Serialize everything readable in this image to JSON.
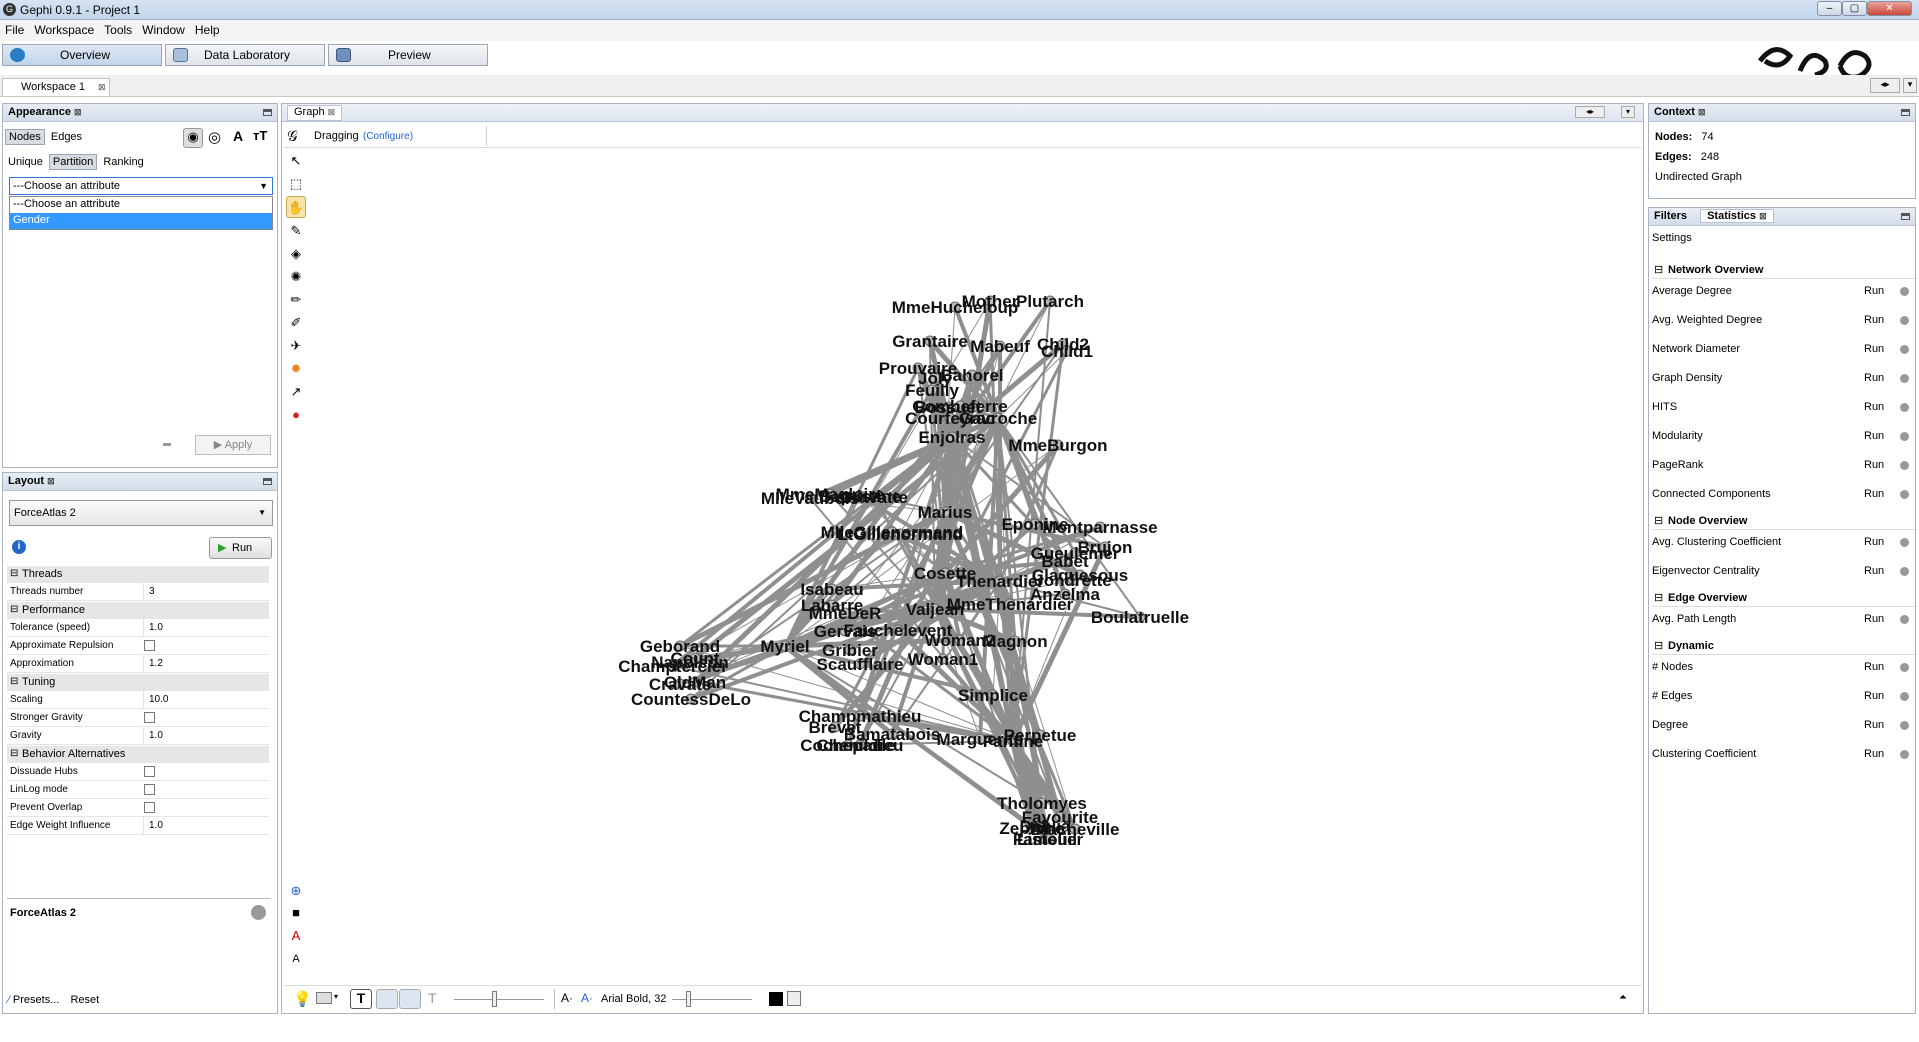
{
  "window": {
    "title": "Gephi 0.9.1 - Project 1"
  },
  "menu": [
    "File",
    "Workspace",
    "Tools",
    "Window",
    "Help"
  ],
  "modes": [
    "Overview",
    "Data Laboratory",
    "Preview"
  ],
  "workspace_tab": "Workspace 1",
  "appearance": {
    "title": "Appearance",
    "tabs": [
      "Nodes",
      "Edges"
    ],
    "modes": [
      "Unique",
      "Partition",
      "Ranking"
    ],
    "dropdown_value": "---Choose an attribute",
    "options": [
      "---Choose an attribute",
      "Gender"
    ],
    "apply": "Apply"
  },
  "layout": {
    "title": "Layout",
    "algorithm": "ForceAtlas 2",
    "run": "Run",
    "sections": {
      "threads": "Threads",
      "performance": "Performance",
      "tuning": "Tuning",
      "behavior": "Behavior Alternatives"
    },
    "props": [
      {
        "label": "Threads number",
        "value": "3"
      },
      {
        "label": "Tolerance (speed)",
        "value": "1.0"
      },
      {
        "label": "Approximate Repulsion",
        "value": ""
      },
      {
        "label": "Approximation",
        "value": "1.2"
      },
      {
        "label": "Scaling",
        "value": "10.0"
      },
      {
        "label": "Stronger Gravity",
        "value": ""
      },
      {
        "label": "Gravity",
        "value": "1.0"
      },
      {
        "label": "Dissuade Hubs",
        "value": ""
      },
      {
        "label": "LinLog mode",
        "value": ""
      },
      {
        "label": "Prevent Overlap",
        "value": ""
      },
      {
        "label": "Edge Weight Influence",
        "value": "1.0"
      }
    ],
    "desc_title": "ForceAtlas 2",
    "presets": "Presets...",
    "reset": "Reset"
  },
  "graph": {
    "tab": "Graph",
    "tool": "Dragging",
    "configure": "(Configure)",
    "font": "Arial Bold, 32",
    "labels": [
      [
        "MmeHucheloup",
        955,
        313
      ],
      [
        "Mother",
        990,
        307
      ],
      [
        "Plutarch",
        1050,
        307
      ],
      [
        "Grantaire",
        930,
        347
      ],
      [
        "Mabeuf",
        1000,
        352
      ],
      [
        "Child2",
        1063,
        350
      ],
      [
        "Child1",
        1067,
        357
      ],
      [
        "Prouvaire",
        918,
        374
      ],
      [
        "Joly",
        935,
        384
      ],
      [
        "Bahorel",
        972,
        381
      ],
      [
        "Feuilly",
        932,
        396
      ],
      [
        "Bossuet",
        948,
        413
      ],
      [
        "Combeferre",
        960,
        412
      ],
      [
        "Courfeyrac",
        950,
        424
      ],
      [
        "Gavroche",
        998,
        424
      ],
      [
        "Enjolras",
        952,
        443
      ],
      [
        "MmeBurgon",
        1058,
        451
      ],
      [
        "MlleVaubois",
        810,
        504
      ],
      [
        "MmeMagloire",
        830,
        500
      ],
      [
        "Baptistine",
        860,
        502
      ],
      [
        "Cravatte",
        874,
        503
      ],
      [
        "Marius",
        945,
        518
      ],
      [
        "MlleGillenormand",
        892,
        538
      ],
      [
        "LtGillenormand",
        900,
        540
      ],
      [
        "Eponine",
        1035,
        530
      ],
      [
        "Montparnasse",
        1100,
        533
      ],
      [
        "Brujon",
        1105,
        553
      ],
      [
        "Gueulemer",
        1075,
        559
      ],
      [
        "Babet",
        1065,
        567
      ],
      [
        "Claquesous",
        1080,
        581
      ],
      [
        "Jondrette",
        1073,
        586
      ],
      [
        "Thenardier",
        1000,
        587
      ],
      [
        "Cosette",
        945,
        579
      ],
      [
        "Anzelma",
        1065,
        600
      ],
      [
        "Isabeau",
        832,
        595
      ],
      [
        "Labarre",
        832,
        611
      ],
      [
        "MmeDeR",
        845,
        619
      ],
      [
        "Valjean",
        935,
        615
      ],
      [
        "MmeThenardier",
        1010,
        610
      ],
      [
        "Boulatruelle",
        1140,
        623
      ],
      [
        "Gervais",
        845,
        637
      ],
      [
        "Fauchelevent",
        898,
        636
      ],
      [
        "Magnon",
        1015,
        647
      ],
      [
        "Woman2",
        960,
        646
      ],
      [
        "Geborand",
        680,
        652
      ],
      [
        "Count",
        695,
        664
      ],
      [
        "Myriel",
        785,
        652
      ],
      [
        "Champtercier",
        673,
        672
      ],
      [
        "Napoleon",
        690,
        668
      ],
      [
        "Cravate",
        680,
        690
      ],
      [
        "OldMan",
        695,
        688
      ],
      [
        "Gribier",
        850,
        656
      ],
      [
        "Scaufflaire",
        860,
        670
      ],
      [
        "Woman1",
        943,
        665
      ],
      [
        "CountessDeLo",
        691,
        705
      ],
      [
        "Simplice",
        993,
        701
      ],
      [
        "Champmathieu",
        860,
        722
      ],
      [
        "Brevet",
        835,
        733
      ],
      [
        "Bamatabois",
        892,
        740
      ],
      [
        "Perpetue",
        1040,
        741
      ],
      [
        "Marguerite",
        980,
        745
      ],
      [
        "Fantine",
        1013,
        747
      ],
      [
        "Cochepaille",
        848,
        751
      ],
      [
        "Chenildieu",
        860,
        751
      ],
      [
        "Tholomyes",
        1042,
        809
      ],
      [
        "Favourite",
        1060,
        823
      ],
      [
        "Dahlia",
        1045,
        832
      ],
      [
        "Zephine",
        1032,
        834
      ],
      [
        "Blacheville",
        1075,
        835
      ],
      [
        "Fameuil",
        1045,
        845
      ],
      [
        "Listolier",
        1050,
        845
      ]
    ]
  },
  "context": {
    "title": "Context",
    "nodes_label": "Nodes:",
    "nodes": "74",
    "edges_label": "Edges:",
    "edges": "248",
    "type": "Undirected Graph"
  },
  "stats": {
    "tabs": [
      "Filters",
      "Statistics"
    ],
    "settings": "Settings",
    "run": "Run",
    "groups": [
      {
        "name": "Network Overview",
        "items": [
          "Average Degree",
          "Avg. Weighted Degree",
          "Network Diameter",
          "Graph Density",
          "HITS",
          "Modularity",
          "PageRank",
          "Connected Components"
        ]
      },
      {
        "name": "Node Overview",
        "items": [
          "Avg. Clustering Coefficient",
          "Eigenvector Centrality"
        ]
      },
      {
        "name": "Edge Overview",
        "items": [
          "Avg. Path Length"
        ]
      },
      {
        "name": "Dynamic",
        "items": [
          "# Nodes",
          "# Edges",
          "Degree",
          "Clustering Coefficient"
        ]
      }
    ]
  }
}
